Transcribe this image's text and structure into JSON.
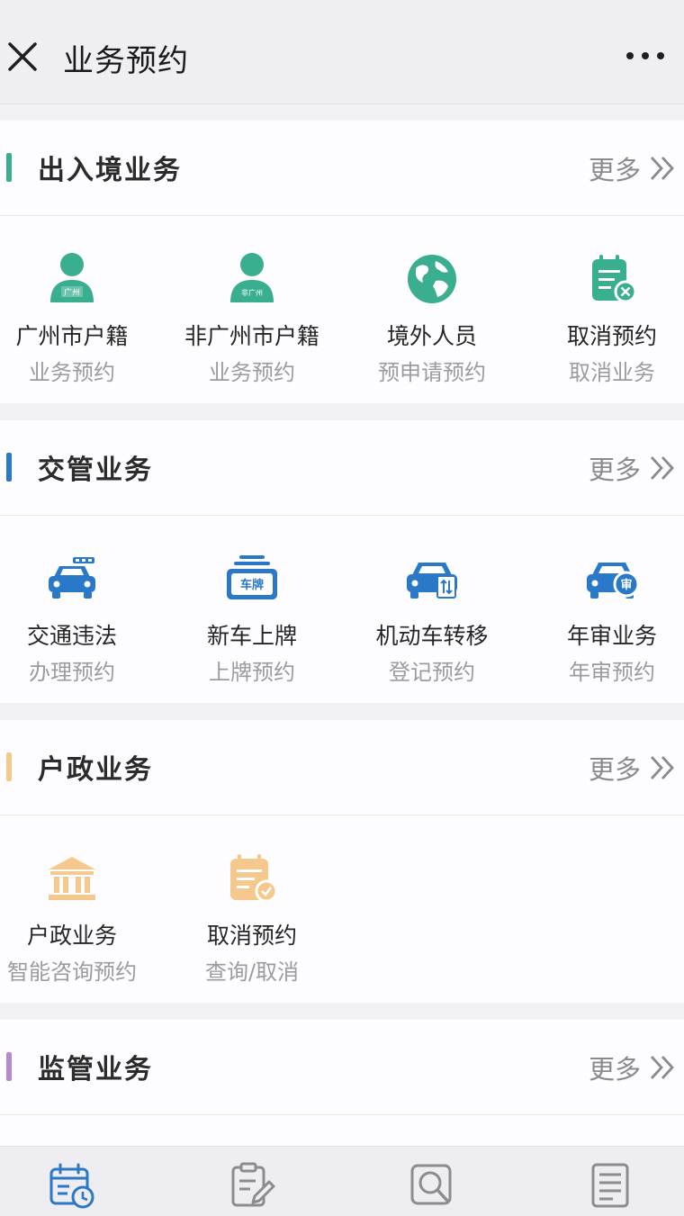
{
  "header": {
    "title": "业务预约"
  },
  "sections": [
    {
      "title": "出入境业务",
      "more": "更多",
      "color": "#3aaf8f",
      "items": [
        {
          "label": "广州市户籍",
          "sub": "业务预约",
          "icon": "person-guangzhou-icon",
          "badge": "广州"
        },
        {
          "label": "非广州市户籍",
          "sub": "业务预约",
          "icon": "person-non-guangzhou-icon",
          "badge": "非广州"
        },
        {
          "label": "境外人员",
          "sub": "预申请预约",
          "icon": "globe-icon"
        },
        {
          "label": "取消预约",
          "sub": "取消业务",
          "icon": "calendar-cancel-icon"
        }
      ]
    },
    {
      "title": "交管业务",
      "more": "更多",
      "color": "#2a78c8",
      "items": [
        {
          "label": "交通违法",
          "sub": "办理预约",
          "icon": "police-car-icon"
        },
        {
          "label": "新车上牌",
          "sub": "上牌预约",
          "icon": "license-plate-icon",
          "badge": "车牌"
        },
        {
          "label": "机动车转移",
          "sub": "登记预约",
          "icon": "car-transfer-icon"
        },
        {
          "label": "年审业务",
          "sub": "年审预约",
          "icon": "car-inspection-icon",
          "badge": "审"
        }
      ]
    },
    {
      "title": "户政业务",
      "more": "更多",
      "color": "#f5c98e",
      "items": [
        {
          "label": "户政业务",
          "sub": "智能咨询预约",
          "icon": "government-building-icon"
        },
        {
          "label": "取消预约",
          "sub": "查询/取消",
          "icon": "calendar-check-icon"
        }
      ]
    },
    {
      "title": "监管业务",
      "more": "更多",
      "color": "#b78ad0",
      "items": []
    }
  ],
  "bottom_nav": [
    {
      "name": "appointment",
      "icon": "calendar-clock-icon",
      "active": true
    },
    {
      "name": "form",
      "icon": "document-edit-icon"
    },
    {
      "name": "search",
      "icon": "search-icon"
    },
    {
      "name": "list",
      "icon": "list-document-icon"
    }
  ],
  "colors": {
    "green": "#3aaf8f",
    "blue": "#2a78c8",
    "orange": "#f5c98e",
    "purple": "#b78ad0",
    "nav_active": "#2a78c8",
    "nav_inactive": "#8c8c90"
  }
}
